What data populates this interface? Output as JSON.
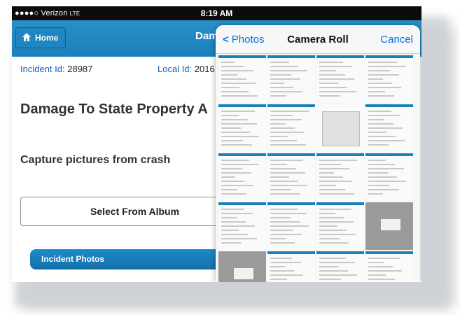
{
  "status_bar": {
    "carrier": "●●●●○ Verizon",
    "network": "LTE",
    "time": "8:19 AM"
  },
  "navbar": {
    "home_label": "Home",
    "title": "Dama"
  },
  "incident": {
    "incident_label": "Incident Id:",
    "incident_value": "28987",
    "local_label": "Local Id:",
    "local_value": "2016"
  },
  "page": {
    "heading": "Damage To State Property A",
    "capture_label": "Capture pictures from crash",
    "select_album_label": "Select From Album",
    "incident_photos_label": "Incident Photos"
  },
  "picker": {
    "back_label": "Photos",
    "title": "Camera Roll",
    "cancel_label": "Cancel",
    "thumbnails": [
      {
        "kind": "doc"
      },
      {
        "kind": "doc"
      },
      {
        "kind": "doc"
      },
      {
        "kind": "doc"
      },
      {
        "kind": "doc"
      },
      {
        "kind": "doc"
      },
      {
        "kind": "map"
      },
      {
        "kind": "doc"
      },
      {
        "kind": "doc"
      },
      {
        "kind": "doc"
      },
      {
        "kind": "doc"
      },
      {
        "kind": "doc"
      },
      {
        "kind": "doc"
      },
      {
        "kind": "doc"
      },
      {
        "kind": "doc"
      },
      {
        "kind": "dark"
      },
      {
        "kind": "dark"
      },
      {
        "kind": "doc"
      },
      {
        "kind": "doc"
      },
      {
        "kind": "doc"
      }
    ]
  },
  "colors": {
    "accent": "#1b7fb9",
    "link": "#0a6fe0",
    "id_label": "#1a5fbf"
  }
}
